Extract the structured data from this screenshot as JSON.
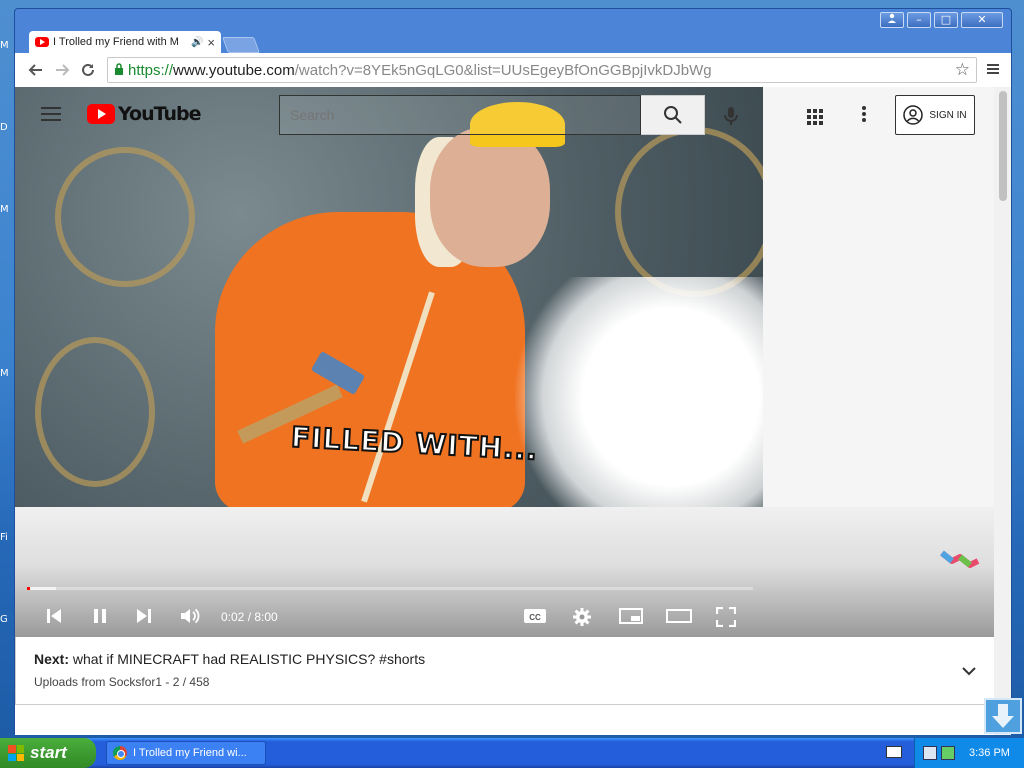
{
  "desktop": {
    "labels": [
      "M",
      "D",
      "M",
      "M",
      "Fi",
      "G"
    ]
  },
  "window": {
    "controls": {
      "user": "&#9823;",
      "minimize": "–",
      "maximize": "□",
      "close": "✕"
    }
  },
  "tab": {
    "title": "I Trolled my Friend with M",
    "audio_icon": "speaker-icon",
    "close": "×"
  },
  "toolbar": {
    "url_scheme": "https://",
    "url_host": "www.youtube.com",
    "url_rest": "/watch?v=8YEk5nGqLG0&list=UUsEgeyBfOnGGBpjIvkDJbWg"
  },
  "youtube": {
    "logo_text": "YouTube",
    "search_placeholder": "Search",
    "signin_label": "SIGN IN"
  },
  "video": {
    "caption": "FILLED WITH...",
    "current_time": "0:02",
    "duration": "8:00",
    "time_display": "0:02 / 8:00",
    "progress_fraction": 0.004,
    "buffer_fraction": 0.04
  },
  "next": {
    "label": "Next:",
    "title": "what if MINECRAFT had REALISTIC PHYSICS? #shorts",
    "subtitle": "Uploads from Socksfor1 - 2 / 458"
  },
  "taskbar": {
    "start_label": "start",
    "task_title": "I Trolled my Friend wi...",
    "clock": "3:36 PM"
  },
  "colors": {
    "yt_red": "#ff0000",
    "xp_blue": "#245edb",
    "start_green": "#3c9b30"
  }
}
